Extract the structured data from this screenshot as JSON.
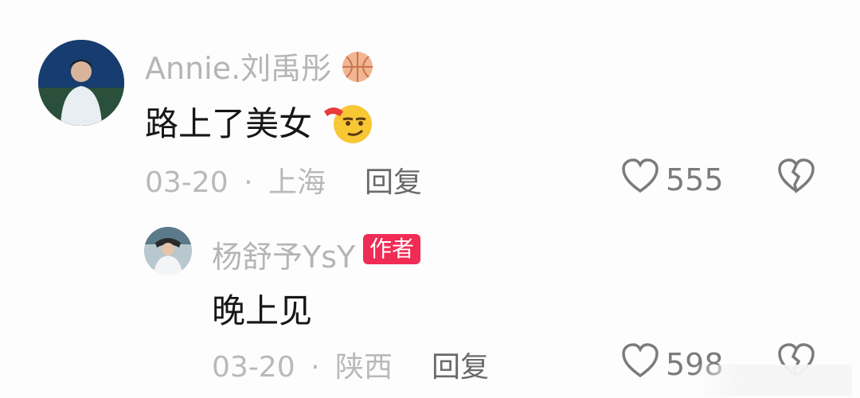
{
  "comments": [
    {
      "author": "Annie.刘禹彤",
      "author_emoji": "basketball-icon",
      "text": "路上了美女",
      "text_emoji": "sly-smirk-emoji",
      "date": "03-20",
      "separator": "·",
      "location": "上海",
      "reply_label": "回复",
      "likes": "555"
    }
  ],
  "replies": [
    {
      "author": "杨舒予YsY",
      "badge": "作者",
      "text": "晚上见",
      "date": "03-20",
      "separator": "·",
      "location": "陕西",
      "reply_label": "回复",
      "likes": "598"
    }
  ],
  "colors": {
    "badge": "#f02c55",
    "name": "#b5b5b5",
    "meta": "#b9b9b9"
  }
}
